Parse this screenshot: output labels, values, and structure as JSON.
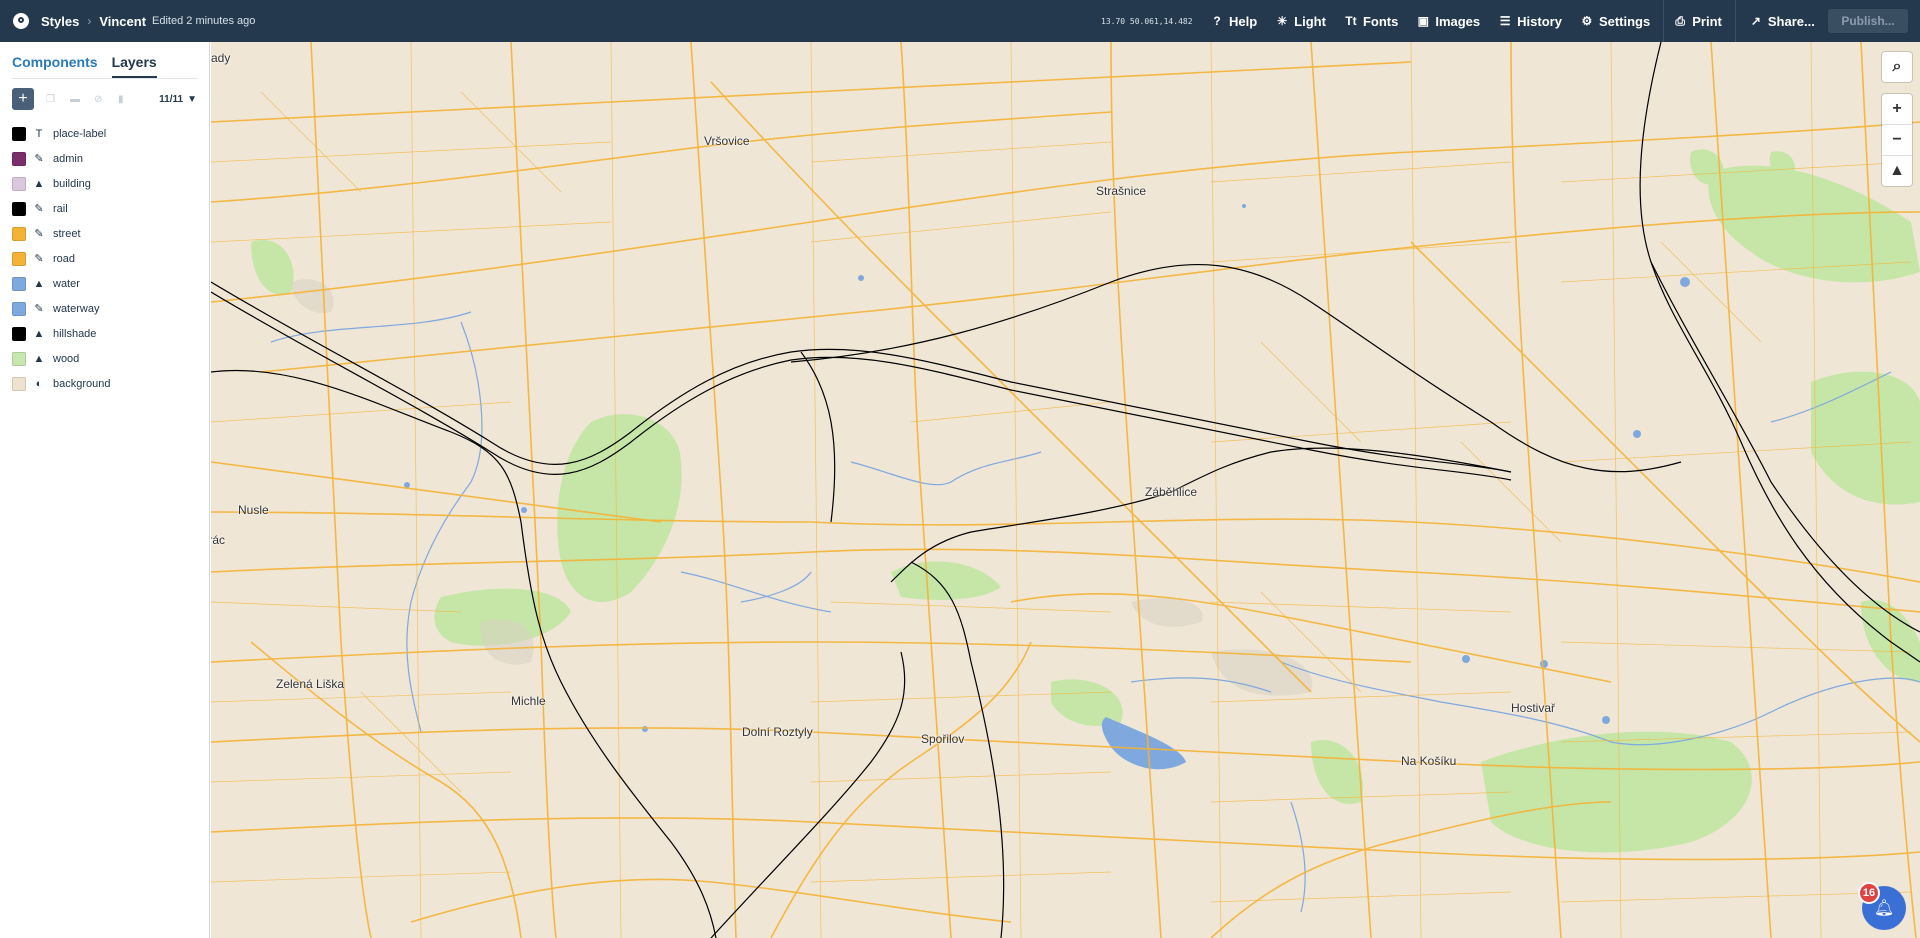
{
  "topbar": {
    "breadcrumb_root": "Styles",
    "style_name": "Vincent",
    "edited": "Edited 2 minutes ago",
    "coords": "13.70 50.061,14.482",
    "nav": [
      {
        "label": "Help",
        "icon": "help-icon",
        "glyph": "?"
      },
      {
        "label": "Light",
        "icon": "sun-icon",
        "glyph": "☀"
      },
      {
        "label": "Fonts",
        "icon": "fonts-icon",
        "glyph": "Tt"
      },
      {
        "label": "Images",
        "icon": "image-icon",
        "glyph": "▣"
      },
      {
        "label": "History",
        "icon": "history-icon",
        "glyph": "☰"
      },
      {
        "label": "Settings",
        "icon": "gear-icon",
        "glyph": "⚙"
      },
      {
        "label": "Print",
        "icon": "print-icon",
        "glyph": "⎙"
      }
    ],
    "share": "Share...",
    "publish": "Publish..."
  },
  "sidebar": {
    "tabs": [
      "Components",
      "Layers"
    ],
    "active_tab": "Layers",
    "layer_count": "11/11",
    "layers": [
      {
        "name": "place-label",
        "color": "#000000",
        "type": "T",
        "type_icon": "text-icon"
      },
      {
        "name": "admin",
        "color": "#7b2d6b",
        "type": "✎",
        "type_icon": "line-icon"
      },
      {
        "name": "building",
        "color": "#dcc6e0",
        "type": "▲",
        "type_icon": "fill-icon"
      },
      {
        "name": "rail",
        "color": "#000000",
        "type": "✎",
        "type_icon": "line-icon"
      },
      {
        "name": "street",
        "color": "#f5b335",
        "type": "✎",
        "type_icon": "line-icon"
      },
      {
        "name": "road",
        "color": "#f5b335",
        "type": "✎",
        "type_icon": "line-icon"
      },
      {
        "name": "water",
        "color": "#7fa8de",
        "type": "▲",
        "type_icon": "fill-icon"
      },
      {
        "name": "waterway",
        "color": "#7fa8de",
        "type": "✎",
        "type_icon": "line-icon"
      },
      {
        "name": "hillshade",
        "color": "#000000",
        "type": "▲",
        "type_icon": "fill-icon"
      },
      {
        "name": "wood",
        "color": "#c8e6b0",
        "type": "▲",
        "type_icon": "fill-icon"
      },
      {
        "name": "background",
        "color": "#efe3cf",
        "type": "◐",
        "type_icon": "background-icon"
      }
    ]
  },
  "map": {
    "labels": [
      "Vršovice",
      "Strašnice",
      "Záběhlice",
      "Nusle",
      "Pankrác",
      "Zelená Liška",
      "Michle",
      "Dolní Roztyly",
      "Spořilov",
      "Hostivař",
      "Na Košíku",
      "ady"
    ],
    "colors": {
      "land": "#efe6d6",
      "road": "#f5b335",
      "wood": "#c6e6a8",
      "water": "#7fa8de",
      "rail": "#000000"
    },
    "notifications": "16"
  }
}
